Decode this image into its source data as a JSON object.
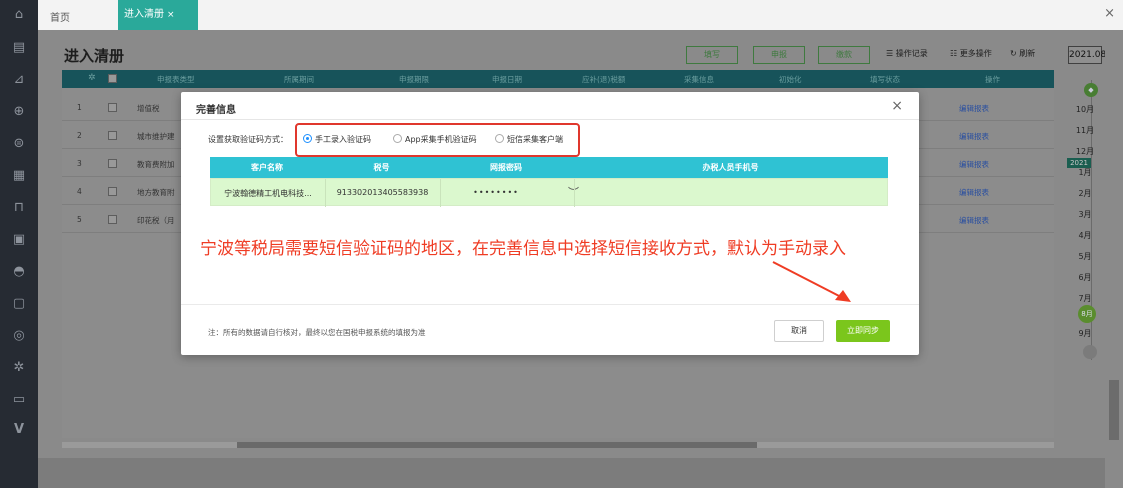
{
  "sidebar": {
    "icons": [
      "home-icon",
      "document-icon",
      "chart-icon",
      "currency-icon",
      "bank-icon",
      "calculator-icon",
      "building-icon",
      "display-icon",
      "archive-icon",
      "receipt-icon",
      "user-icon",
      "settings-icon",
      "monitor-icon",
      "v-icon"
    ]
  },
  "tabs": {
    "home": "首页",
    "active": "进入清册",
    "active_close": "×",
    "close_all": "×"
  },
  "page": {
    "title": "进入清册",
    "toolbar": {
      "btn1": "填写",
      "btn2": "申报",
      "btn3": "缴款",
      "log": "操作记录",
      "more": "更多操作",
      "refresh": "刷新"
    }
  },
  "grid": {
    "headers": [
      "申报表类型",
      "所属期间",
      "申报期限",
      "申报日期",
      "应补(退)税额",
      "采集信息",
      "初始化",
      "填写状态",
      "操作"
    ],
    "rows": [
      {
        "num": "1",
        "name": "增值税",
        "op": "编辑报表"
      },
      {
        "num": "2",
        "name": "城市维护建",
        "op": "编辑报表"
      },
      {
        "num": "3",
        "name": "教育费附加",
        "op": "编辑报表"
      },
      {
        "num": "4",
        "name": "地方教育附",
        "op": "编辑报表"
      },
      {
        "num": "5",
        "name": "印花税（月",
        "op": "编辑报表"
      }
    ]
  },
  "timeline": {
    "year": "2021.08",
    "months": [
      "10月",
      "11月",
      "12月",
      "1月",
      "2月",
      "3月",
      "4月",
      "5月",
      "6月",
      "7月",
      "8月",
      "9月"
    ],
    "badge": "2021"
  },
  "modal": {
    "title": "完善信息",
    "close": "×",
    "method_label": "设置获取验证码方式：",
    "options": [
      {
        "label": "手工录入验证码",
        "selected": true
      },
      {
        "label": "App采集手机验证码",
        "selected": false
      },
      {
        "label": "短信采集客户端",
        "selected": false
      }
    ],
    "table": {
      "headers": [
        "客户名称",
        "税号",
        "网报密码",
        "办税人员手机号"
      ],
      "row": {
        "customer": "宁波翰德精工机电科技...",
        "tax_id": "913302013405583938",
        "password": "••••••••",
        "phone": ""
      }
    },
    "annotation": "宁波等税局需要短信验证码的地区，在完善信息中选择短信接收方式，默认为手动录入",
    "footer_note": "注：所有的数据请自行核对，最终以您在国税申报系统的填报为准",
    "cancel": "取消",
    "sync": "立即同步"
  },
  "colors": {
    "accent": "#2aa99a",
    "table_header": "#2fc2d3",
    "table_row": "#dbf8ce",
    "highlight": "#e0372d",
    "sync_button": "#7bc61c",
    "annotation": "#ef3c24"
  }
}
